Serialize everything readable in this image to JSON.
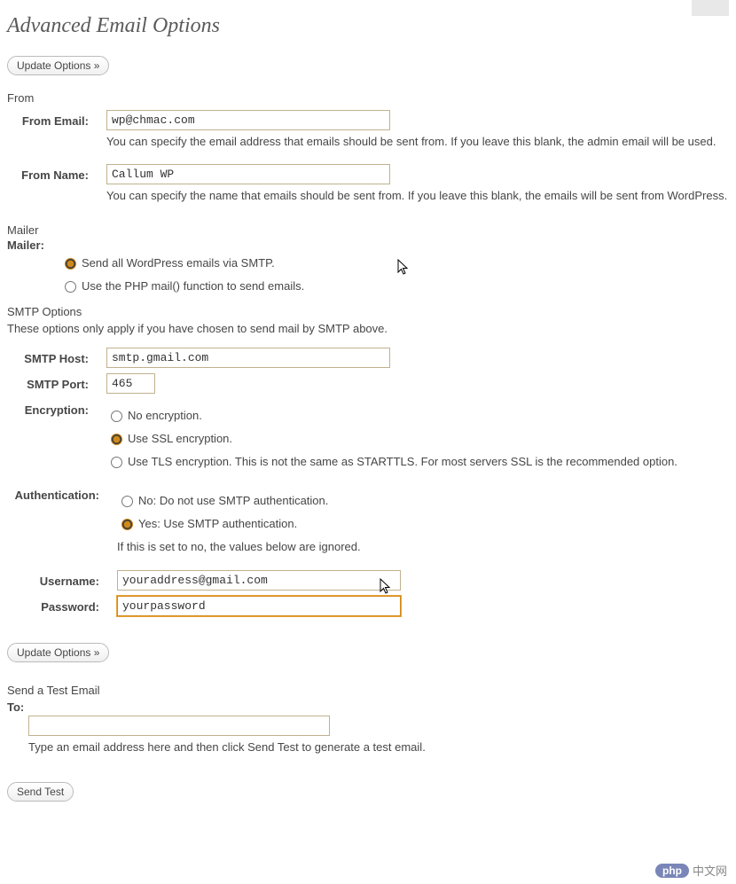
{
  "page": {
    "title": "Advanced Email Options"
  },
  "buttons": {
    "update_top": "Update Options »",
    "update_bottom": "Update Options »",
    "send_test": "Send Test"
  },
  "from": {
    "heading": "From",
    "email_label": "From Email:",
    "email_value": "wp@chmac.com",
    "email_help": "You can specify the email address that emails should be sent from. If you leave this blank, the admin email will be used.",
    "name_label": "From Name:",
    "name_value": "Callum WP",
    "name_help": "You can specify the name that emails should be sent from. If you leave this blank, the emails will be sent from WordPress."
  },
  "mailer": {
    "heading": "Mailer",
    "label": "Mailer:",
    "opt_smtp": "Send all WordPress emails via SMTP.",
    "opt_php": "Use the PHP mail() function to send emails."
  },
  "smtp": {
    "heading": "SMTP Options",
    "desc": "These options only apply if you have chosen to send mail by SMTP above.",
    "host_label": "SMTP Host:",
    "host_value": "smtp.gmail.com",
    "port_label": "SMTP Port:",
    "port_value": "465",
    "enc_label": "Encryption:",
    "enc_none": "No encryption.",
    "enc_ssl": "Use SSL encryption.",
    "enc_tls": "Use TLS encryption. This is not the same as STARTTLS. For most servers SSL is the recommended option.",
    "auth_label": "Authentication:",
    "auth_no": "No: Do not use SMTP authentication.",
    "auth_yes": "Yes: Use SMTP authentication.",
    "auth_help": "If this is set to no, the values below are ignored.",
    "user_label": "Username:",
    "user_value": "youraddress@gmail.com",
    "pass_label": "Password:",
    "pass_value": "yourpassword"
  },
  "test": {
    "heading": "Send a Test Email",
    "to_label": "To:",
    "to_value": "",
    "help": "Type an email address here and then click Send Test to generate a test email."
  },
  "watermark": {
    "badge": "php",
    "text": "中文网"
  }
}
